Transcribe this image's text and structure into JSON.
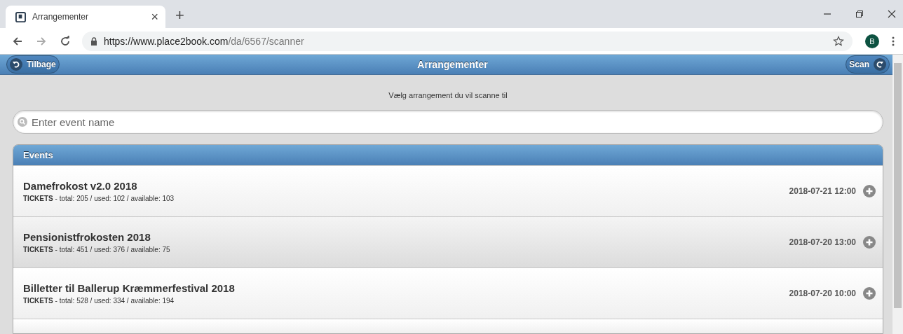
{
  "browser": {
    "tab_title": "Arrangementer",
    "tab_close": "×",
    "new_tab": "+",
    "url_host": "https://www.place2book.com",
    "url_path": "/da/6567/scanner",
    "profile": "B"
  },
  "header": {
    "back": "Tilbage",
    "title": "Arrangementer",
    "scan": "Scan"
  },
  "prompt": "Vælg arrangement du vil scanne til",
  "search": {
    "placeholder": "Enter event name"
  },
  "events": {
    "title": "Events",
    "items": [
      {
        "name": "Damefrokost v2.0 2018",
        "tickets": "**TICKETS** - total: 205 / used: 102 / available: 103",
        "date": "2018-07-21 12:00",
        "selected": false
      },
      {
        "name": "Pensionistfrokosten 2018",
        "tickets": "**TICKETS** - total: 451 / used: 376 / available: 75",
        "date": "2018-07-20 13:00",
        "selected": true
      },
      {
        "name": "Billetter til Ballerup Kræmmerfestival 2018",
        "tickets": "**TICKETS** - total: 528 / used: 334 / available: 194",
        "date": "2018-07-20 10:00",
        "selected": false
      }
    ]
  }
}
